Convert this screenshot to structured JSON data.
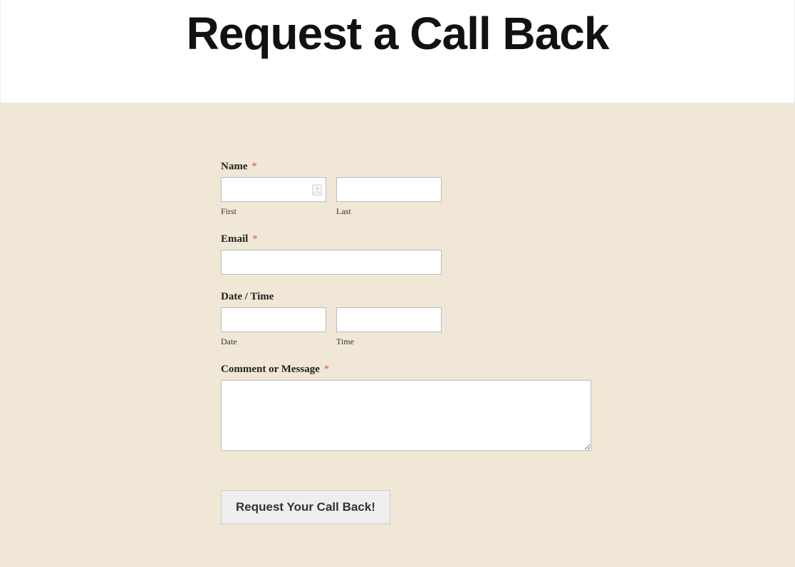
{
  "header": {
    "title": "Request a Call Back"
  },
  "form": {
    "name": {
      "label": "Name",
      "required": "*",
      "first_sublabel": "First",
      "last_sublabel": "Last"
    },
    "email": {
      "label": "Email",
      "required": "*"
    },
    "datetime": {
      "label": "Date / Time",
      "date_sublabel": "Date",
      "time_sublabel": "Time"
    },
    "comment": {
      "label": "Comment or Message",
      "required": "*"
    },
    "submit": {
      "label": "Request Your Call Back!"
    }
  }
}
